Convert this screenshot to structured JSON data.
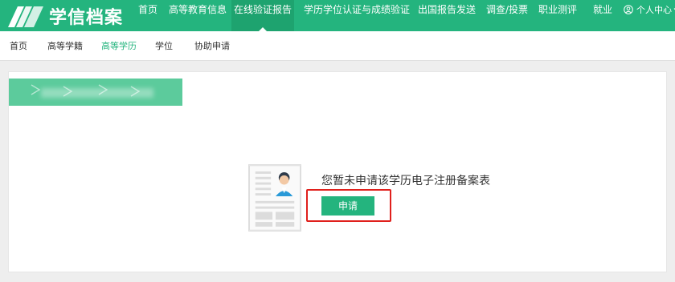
{
  "brand": {
    "name": "学信档案"
  },
  "topnav": {
    "items": [
      {
        "label": "首页"
      },
      {
        "label": "高等教育信息"
      },
      {
        "label": "在线验证报告"
      },
      {
        "label": "学历学位认证与成绩验证"
      },
      {
        "label": "出国报告发送"
      },
      {
        "label": "调查/投票"
      },
      {
        "label": "职业测评"
      },
      {
        "label": "就业"
      }
    ],
    "active_index": 2,
    "user_label": "个人中心"
  },
  "subnav": {
    "items": [
      {
        "label": "首页"
      },
      {
        "label": "高等学籍"
      },
      {
        "label": "高等学历"
      },
      {
        "label": "学位"
      },
      {
        "label": "协助申请"
      }
    ],
    "active_index": 2
  },
  "main": {
    "empty_message": "您暂未申请该学历电子注册备案表",
    "apply_button": "申请"
  },
  "colors": {
    "brand_green": "#24b47e",
    "active_nav": "#1ea36f",
    "highlight_red": "#e0201c"
  }
}
